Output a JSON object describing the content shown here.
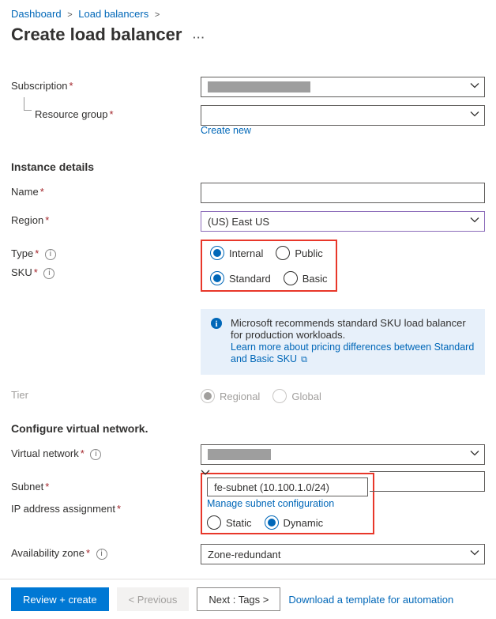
{
  "breadcrumb": {
    "items": [
      "Dashboard",
      "Load balancers"
    ],
    "trailing_sep": ">"
  },
  "page_title": "Create load balancer",
  "labels": {
    "subscription": "Subscription",
    "resource_group": "Resource group",
    "create_new": "Create new",
    "instance_details": "Instance details",
    "name": "Name",
    "region": "Region",
    "type": "Type",
    "sku": "SKU",
    "tier": "Tier",
    "configure_vnet": "Configure virtual network.",
    "virtual_network": "Virtual network",
    "subnet": "Subnet",
    "manage_subnet": "Manage subnet configuration",
    "ip_assignment": "IP address assignment",
    "avail_zone": "Availability zone"
  },
  "values": {
    "region": "(US) East US",
    "subnet": "fe-subnet (10.100.1.0/24)",
    "avail_zone": "Zone-redundant"
  },
  "radios": {
    "type": {
      "internal": "Internal",
      "public": "Public"
    },
    "sku": {
      "standard": "Standard",
      "basic": "Basic"
    },
    "tier": {
      "regional": "Regional",
      "global": "Global"
    },
    "ip": {
      "static": "Static",
      "dynamic": "Dynamic"
    }
  },
  "info_banner": {
    "text": "Microsoft recommends standard SKU load balancer for production workloads.",
    "link": "Learn more about pricing differences between Standard and Basic SKU"
  },
  "footer": {
    "review": "Review + create",
    "previous": "< Previous",
    "next": "Next : Tags >",
    "download": "Download a template for automation"
  }
}
